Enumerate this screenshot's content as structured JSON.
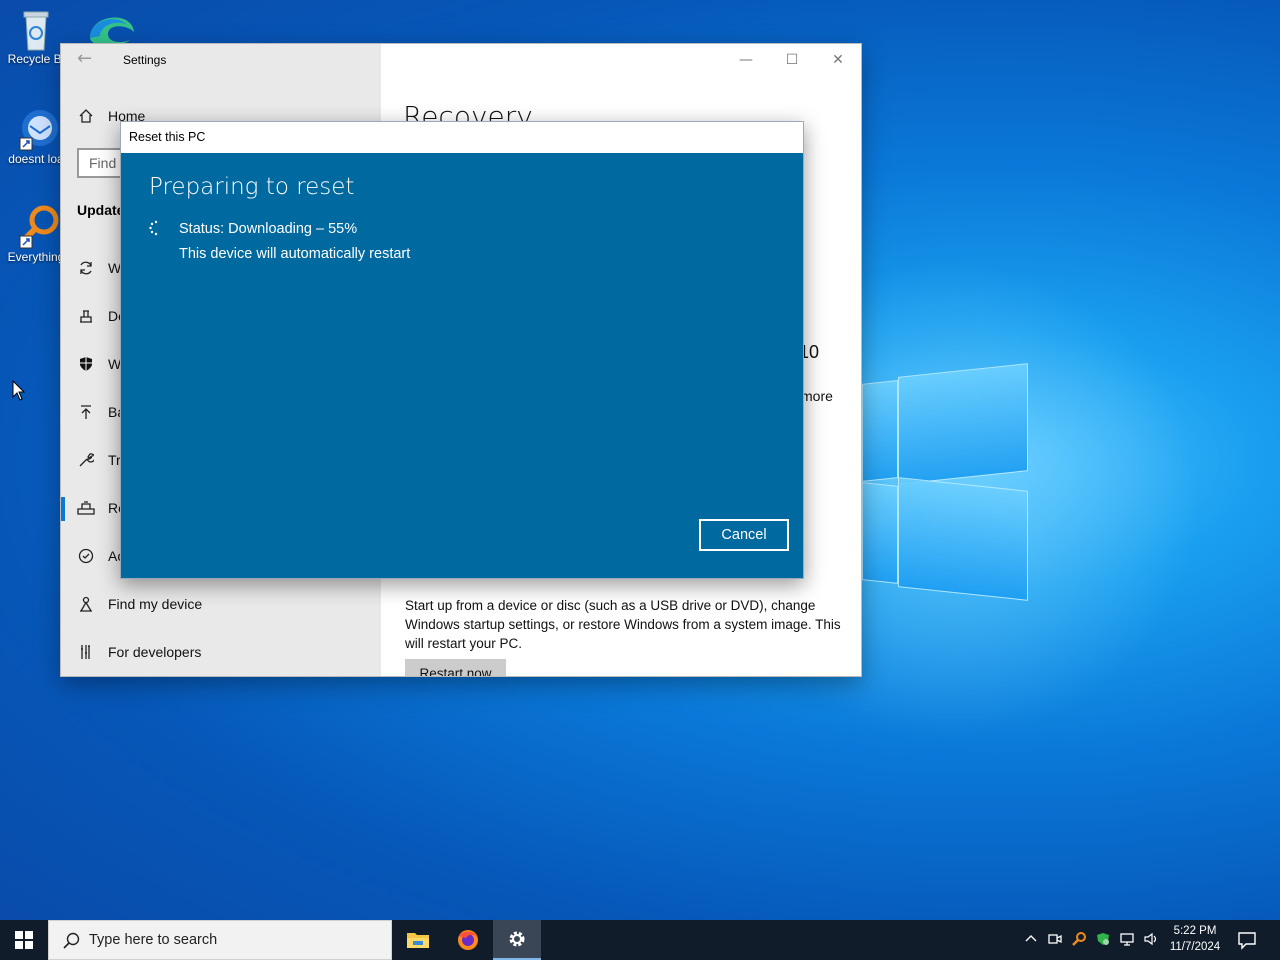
{
  "desktop": {
    "icons": [
      {
        "label": "Recycle Bi",
        "icon": "recycle-bin-icon"
      },
      {
        "label": "doesnt loa",
        "icon": "thunderbird-icon"
      },
      {
        "label": "Everything",
        "icon": "everything-search-icon"
      }
    ]
  },
  "settings": {
    "title": "Settings",
    "home": "Home",
    "search_placeholder": "Find",
    "section": "Update",
    "nav": [
      {
        "label": "W",
        "icon": "sync-icon"
      },
      {
        "label": "De",
        "icon": "delivery-optimization-icon"
      },
      {
        "label": "W",
        "icon": "shield-icon"
      },
      {
        "label": "Ba",
        "icon": "backup-icon"
      },
      {
        "label": "Tr",
        "icon": "wrench-icon"
      },
      {
        "label": "Re",
        "icon": "recovery-icon"
      },
      {
        "label": "Ac",
        "icon": "activation-icon"
      },
      {
        "label": "Find my device",
        "icon": "find-device-icon"
      },
      {
        "label": "For developers",
        "icon": "developer-tools-icon"
      }
    ],
    "content": {
      "title": "Recovery",
      "partial_heading": "10",
      "partial_link": "more",
      "advanced_desc": "Start up from a device or disc (such as a USB drive or DVD), change Windows startup settings, or restore Windows from a system image. This will restart your PC.",
      "restart_button": "Restart now"
    },
    "controls": {
      "minimize": "—",
      "maximize": "☐",
      "close": "✕"
    }
  },
  "dialog": {
    "title": "Reset this PC",
    "heading": "Preparing to reset",
    "status": "Status: Downloading – 55%",
    "message": "This device will automatically restart",
    "cancel": "Cancel"
  },
  "taskbar": {
    "search_placeholder": "Type here to search",
    "apps": [
      "file-explorer-icon",
      "firefox-icon",
      "settings-gear-icon"
    ],
    "clock_time": "5:22 PM",
    "clock_date": "11/7/2024"
  }
}
